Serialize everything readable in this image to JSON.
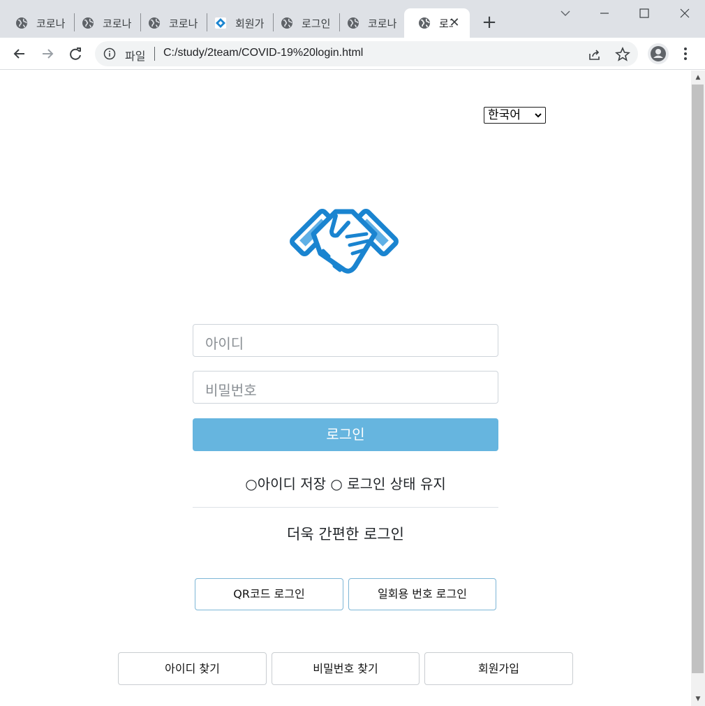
{
  "browser": {
    "tabs": [
      {
        "label": "코로나",
        "icon": "globe-icon"
      },
      {
        "label": "코로나",
        "icon": "globe-icon"
      },
      {
        "label": "코로나",
        "icon": "globe-icon"
      },
      {
        "label": "회원가",
        "icon": "site-favicon"
      },
      {
        "label": "로그인",
        "icon": "globe-icon"
      },
      {
        "label": "코로나",
        "icon": "globe-icon"
      },
      {
        "label": "로그",
        "icon": "globe-icon",
        "active": true
      }
    ],
    "new_tab": "+",
    "close_tab": "✕",
    "url_scheme": "파일",
    "url": "C:/study/2team/COVID-19%20login.html"
  },
  "page": {
    "language": "한국어",
    "username_placeholder": "아이디",
    "password_placeholder": "비밀번호",
    "login_button": "로그인",
    "options_text": "○아이디 저장 ○ 로그인 상태 유지",
    "simple_login_title": "더욱 간편한 로그인",
    "qr_login_button": "QR코드 로그인",
    "otp_login_button": "일회용 번호 로그인",
    "find_id_button": "아이디 찾기",
    "find_password_button": "비밀번호 찾기",
    "signup_button": "회원가입"
  },
  "colors": {
    "accent": "#1a84d0",
    "login_button_bg": "#66b5df",
    "outline_border": "#7db6d6",
    "tabstrip_bg": "#dee1e6"
  }
}
